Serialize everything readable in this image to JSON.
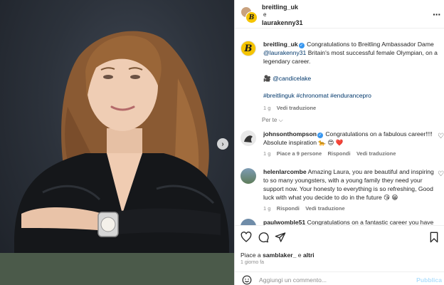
{
  "header": {
    "user1": "breitling_uk",
    "conjunction": "e",
    "user2": "laurakenny31",
    "more_icon": "more-horizontal-icon"
  },
  "caption": {
    "username": "breitling_uk",
    "text1": " Congratulations to Breitling Ambassador Dame ",
    "mention": "@laurakenny31",
    "text2": " Britain's most successful female Olympian, on a legendary career.",
    "credit_emoji": "🎥",
    "credit": "@candicelake",
    "hashtags": "#breitlinguk #chronomat #endurancepro",
    "time": "1 g",
    "translate": "Vedi traduzione"
  },
  "see_all": "Per te",
  "comments": [
    {
      "username": "johnsonthompson",
      "text": " Congratulations on a fabulous career!!!! Absolute inspiration 🐆 😍 ❤️",
      "time": "1 g",
      "likes": "Piace a 9 persone",
      "reply": "Rispondi",
      "translate": "Vedi traduzione",
      "avatar_color": "#e8e8e8"
    },
    {
      "username": "helenlarcombe",
      "text": " Amazing Laura, you are beautiful and inspiring to so many youngsters, with a young family they need your support now. Your honesty to everything is so refreshing, Good luck with what you decide to do in the future 😘 😁",
      "time": "1 g",
      "reply": "Rispondi",
      "translate": "Vedi traduzione",
      "avatar_color": "#7d9bb5"
    },
    {
      "username": "paulwomble51",
      "text": " Congratulations on a fantastic career you have",
      "avatar_color": "#6f8ca8"
    }
  ],
  "footer": {
    "likes_prefix": "Piace a ",
    "likes_user": "samblaker_",
    "likes_mid": " e ",
    "likes_others": "altri",
    "time": "1 giorno fa",
    "comment_placeholder": "Aggiungi un commento...",
    "publish": "Pubblica"
  },
  "icons": {
    "heart": "heart-icon",
    "comment": "comment-icon",
    "share": "share-icon",
    "bookmark": "bookmark-icon",
    "emoji": "emoji-icon",
    "next": "chevron-right-icon"
  },
  "colors": {
    "brand_yellow": "#f5c400",
    "link_blue": "#00376b",
    "verified_blue": "#3897f0"
  }
}
